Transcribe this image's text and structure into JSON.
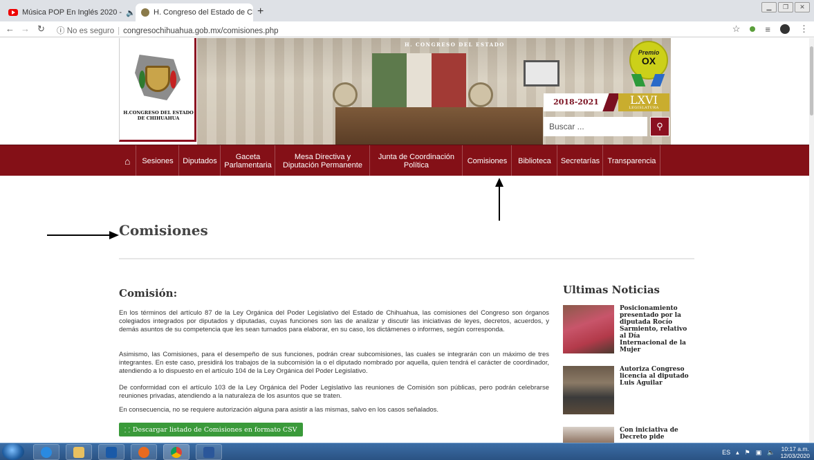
{
  "browser": {
    "tabs": [
      {
        "title": "Música POP En Inglés 2020 -",
        "active": false,
        "audio": true
      },
      {
        "title": "H. Congreso del Estado de Chihu",
        "active": true
      }
    ],
    "new_tab_label": "+",
    "security_label": "No es seguro",
    "url": "congresochihuahua.gob.mx/comisiones.php"
  },
  "header": {
    "logo_text": "H.CONGRESO DEL ESTADO DE CHIHUAHUA",
    "banner_text": "H. CONGRESO DEL ESTADO",
    "premio_label": "Premio",
    "premio_mark": "OX",
    "legislatura_years": "2018-2021",
    "legislatura_number": "LXVI",
    "legislatura_word": "LEGISLATURA",
    "search_placeholder": "Buscar ...",
    "search_icon": "search-icon"
  },
  "nav": {
    "home_icon": "home-icon",
    "items": [
      "Sesiones",
      "Diputados",
      "Gaceta Parlamentaria",
      "Mesa Directiva y Diputación Permanente",
      "Junta de Coordinación Política",
      "Comisiones",
      "Biblioteca",
      "Secretarías",
      "Transparencia"
    ]
  },
  "content": {
    "page_title": "Comisiones",
    "section_title": "Comisión:",
    "paragraphs": [
      "En los términos del artículo 87 de la Ley Orgánica del Poder Legislativo del Estado de Chihuahua, las comisiones del Congreso son órganos colegiados integrados por diputados y diputadas, cuyas funciones son las de analizar y discutir las iniciativas de leyes, decretos, acuerdos, y demás asuntos de su competencia que les sean turnados para elaborar, en su caso, los dictámenes o informes, según corresponda.",
      "Asimismo, las Comisiones, para el desempeño de sus funciones, podrán crear subcomisiones, las cuales se integrarán con un máximo de tres integrantes. En este caso, presidirá los trabajos de la subcomisión la o el diputado nombrado por aquella, quien tendrá el carácter de coordinador, atendiendo a lo dispuesto en el artículo 104 de la Ley Orgánica del Poder Legislativo.",
      "De conformidad con el artículo 103 de la Ley Orgánica del Poder Legislativo las reuniones de Comisión son públicas, pero podrán celebrarse reuniones privadas, atendiendo a la naturaleza de los asuntos que se traten.",
      "En consecuencia, no se requiere autorización alguna para asistir a las mismas, salvo en los casos señalados."
    ],
    "csv_button": "Descargar listado de Comisiones en formato CSV"
  },
  "news": {
    "title": "Ultimas Noticias",
    "items": [
      "Posicionamiento presentado por la diputada Rocío Sarmiento, relativo al Día Internacional de la Mujer",
      "Autoriza Congreso licencia al diputado Luis Aguilar",
      "Con iniciativa de Decreto pide"
    ]
  },
  "taskbar": {
    "language": "ES",
    "time": "10:17 a.m.",
    "date": "12/03/2020"
  }
}
